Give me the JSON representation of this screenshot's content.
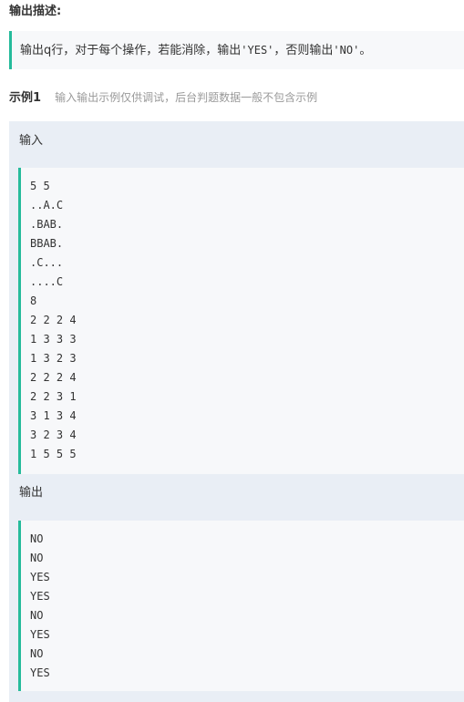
{
  "output_description": {
    "title": "输出描述:",
    "text_before": "输出q行，对于每个操作，若能消除，输出",
    "code_yes": "'YES'",
    "text_middle": "，否则输出",
    "code_no": "'NO'",
    "text_end": "。"
  },
  "example": {
    "title": "示例1",
    "note": "输入输出示例仅供调试，后台判题数据一般不包含示例",
    "input_label": "输入",
    "input_lines": [
      "5 5",
      "..A.C",
      ".BAB.",
      "BBAB.",
      ".C...",
      "....C",
      "8",
      "2 2 2 4",
      "1 3 3 3",
      "1 3 2 3",
      "2 2 2 4",
      "2 2 3 1",
      "3 1 3 4",
      "3 2 3 4",
      "1 5 5 5"
    ],
    "output_label": "输出",
    "output_lines": [
      "NO",
      "NO",
      "YES",
      "YES",
      "NO",
      "YES",
      "NO",
      "YES"
    ]
  },
  "colors": {
    "accent": "#25bb9b",
    "panel_bg": "#e9eef5",
    "code_bg": "#f7f8fa"
  }
}
